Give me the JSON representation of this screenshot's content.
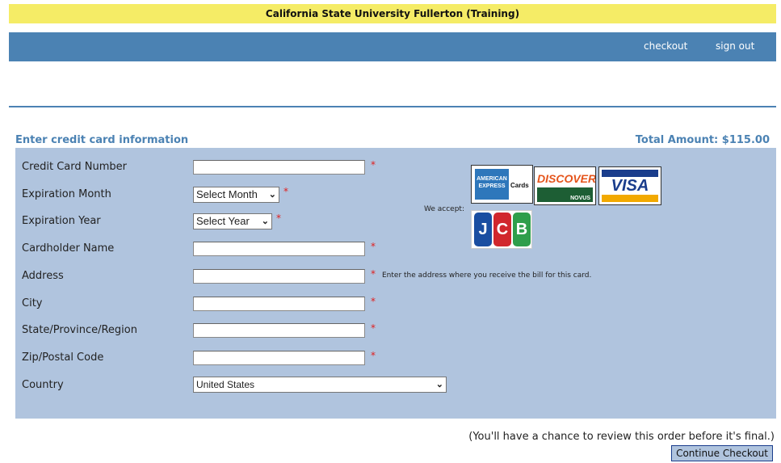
{
  "banner": {
    "title": "California State University Fullerton (Training)"
  },
  "nav": {
    "checkout": "checkout",
    "sign_out": "sign out"
  },
  "section": {
    "title": "Enter credit card information",
    "total": "Total Amount: $115.00"
  },
  "form": {
    "required_mark": "*",
    "fields": {
      "card_number": {
        "label": "Credit Card Number",
        "value": ""
      },
      "exp_month": {
        "label": "Expiration Month",
        "selected": "Select Month"
      },
      "exp_year": {
        "label": "Expiration Year",
        "selected": "Select Year"
      },
      "cardholder": {
        "label": "Cardholder Name",
        "value": ""
      },
      "address": {
        "label": "Address",
        "value": "",
        "hint": "Enter the address where you receive the bill for this card."
      },
      "city": {
        "label": "City",
        "value": ""
      },
      "state": {
        "label": "State/Province/Region",
        "value": ""
      },
      "zip": {
        "label": "Zip/Postal Code",
        "value": ""
      },
      "country": {
        "label": "Country",
        "selected": "United States"
      }
    }
  },
  "accepted": {
    "label": "We accept:",
    "cards": {
      "amex": {
        "brand_text": "AMERICAN EXPRESS",
        "extra_text": "Cards"
      },
      "discover": {
        "brand_text": "DISCOVER",
        "extra_text": "NOVUS"
      },
      "visa": {
        "brand_text": "VISA"
      },
      "jcb": {
        "letters": [
          "J",
          "C",
          "B"
        ]
      }
    },
    "icons": [
      "amex-card-icon",
      "discover-card-icon",
      "visa-card-icon",
      "jcb-card-icon",
      "chevron-down-icon"
    ]
  },
  "footer": {
    "note": "(You'll have a chance to review this order before it's final.)",
    "continue_label": "Continue Checkout"
  },
  "colors": {
    "banner_bg": "#f5ec66",
    "nav_bg": "#4b82b3",
    "panel_bg": "#b0c4de",
    "heading": "#4b82b3",
    "required": "#e02020"
  }
}
